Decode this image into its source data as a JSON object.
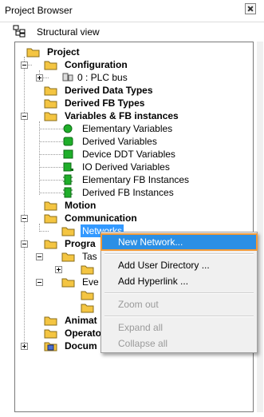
{
  "window": {
    "title": "Project Browser"
  },
  "view": {
    "label": "Structural view"
  },
  "tree": {
    "project": "Project",
    "configuration": "Configuration",
    "plc_bus": "0 : PLC bus",
    "derived_data_types": "Derived Data Types",
    "derived_fb_types": "Derived FB Types",
    "variables_fb": "Variables & FB instances",
    "elementary_variables": "Elementary Variables",
    "derived_variables": "Derived Variables",
    "device_ddt_variables": "Device DDT Variables",
    "io_derived_variables": "IO Derived Variables",
    "elementary_fb_instances": "Elementary FB Instances",
    "derived_fb_instances": "Derived FB Instances",
    "motion": "Motion",
    "communication": "Communication",
    "networks": "Networks",
    "program": "Progra",
    "tasks": "Tas",
    "events": "Eve",
    "animation": "Animat",
    "operator": "Operato",
    "documentation": "Docum"
  },
  "context_menu": {
    "new_network": "New Network...",
    "add_user_directory": "Add User Directory ...",
    "add_hyperlink": "Add Hyperlink ...",
    "zoom_out": "Zoom out",
    "expand_all": "Expand all",
    "collapse_all": "Collapse all"
  },
  "colors": {
    "selection": "#3399ff",
    "menu_highlight": "#2b8fe5",
    "highlight_outline": "#f29a38",
    "folder": "#f4c542",
    "variable_green": "#1fae2a"
  }
}
